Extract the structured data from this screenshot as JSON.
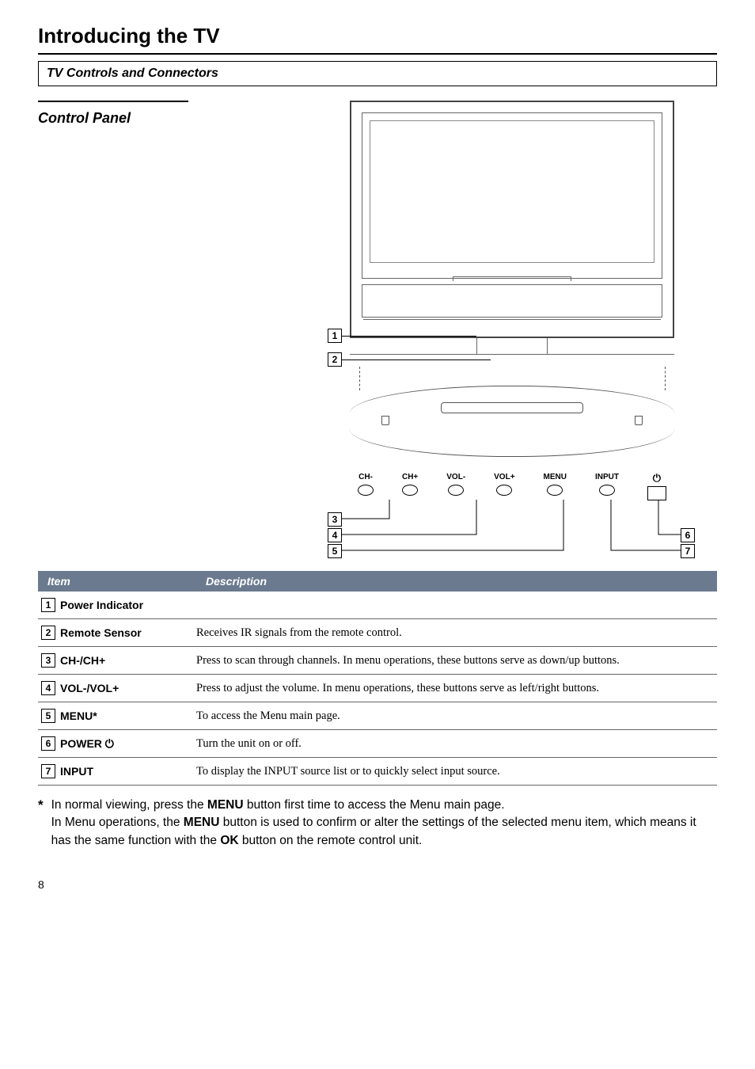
{
  "heading": "Introducing the TV",
  "section_title": "TV Controls and Connectors",
  "sub_heading": "Control Panel",
  "diagram": {
    "callouts": [
      "1",
      "2",
      "3",
      "4",
      "5",
      "6",
      "7"
    ],
    "buttons": [
      {
        "label": "CH-"
      },
      {
        "label": "CH+"
      },
      {
        "label": "VOL-"
      },
      {
        "label": "VOL+"
      },
      {
        "label": "MENU"
      },
      {
        "label": "INPUT"
      }
    ],
    "power_label": ""
  },
  "table": {
    "head_item": "Item",
    "head_desc": "Description",
    "rows": [
      {
        "n": "1",
        "item": "Power Indicator",
        "desc": ""
      },
      {
        "n": "2",
        "item": "Remote Sensor",
        "desc": "Receives IR signals from the remote control."
      },
      {
        "n": "3",
        "item": "CH-/CH+",
        "desc": "Press to scan through channels. In menu operations, these buttons serve as down/up buttons."
      },
      {
        "n": "4",
        "item": "VOL-/VOL+",
        "desc": "Press to adjust the volume. In menu operations, these buttons serve as left/right buttons."
      },
      {
        "n": "5",
        "item": "MENU*",
        "desc": "To access the Menu main page."
      },
      {
        "n": "6",
        "item": "POWER ⏻",
        "desc": "Turn the unit on or off."
      },
      {
        "n": "7",
        "item": "INPUT",
        "desc": "To display the INPUT source list or to quickly select input source."
      }
    ]
  },
  "footnote": {
    "star": "*",
    "line1_a": "In normal viewing, press the ",
    "line1_b": "MENU",
    "line1_c": " button first time to access the Menu main page.",
    "line2_a": "In Menu operations, the ",
    "line2_b": "MENU",
    "line2_c": " button is used to confirm or alter the settings of the selected menu item, which means it has the same function with the ",
    "line2_d": "OK",
    "line2_e": " button on the remote control unit."
  },
  "page_number": "8"
}
